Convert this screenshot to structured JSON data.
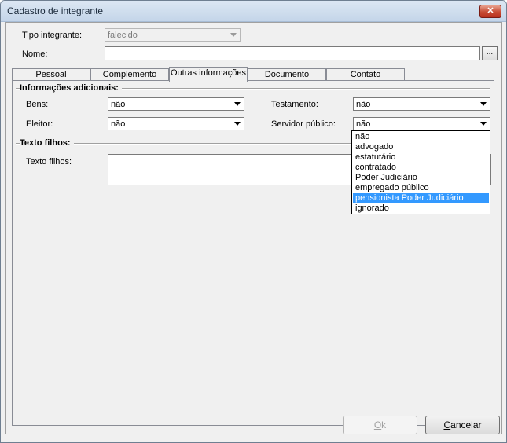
{
  "window": {
    "title": "Cadastro de integrante",
    "close_label": "✕"
  },
  "form": {
    "tipo_label": "Tipo integrante:",
    "tipo_value": "falecido",
    "nome_label": "Nome:",
    "nome_value": "",
    "ellipsis_label": "..."
  },
  "tabs": [
    {
      "label": "Pessoal"
    },
    {
      "label": "Complemento"
    },
    {
      "label": "Outras informações"
    },
    {
      "label": "Documento"
    },
    {
      "label": "Contato"
    }
  ],
  "group_adicionais": {
    "title": "Informações adicionais:",
    "bens_label": "Bens:",
    "bens_value": "não",
    "eleitor_label": "Eleitor:",
    "eleitor_value": "não",
    "testamento_label": "Testamento:",
    "testamento_value": "não",
    "servidor_label": "Servidor público:",
    "servidor_value": "não"
  },
  "group_filhos": {
    "title": "Texto filhos:",
    "field_label": "Texto filhos:"
  },
  "servidor_dropdown": {
    "items": [
      "não",
      "advogado",
      "estatutário",
      "contratado",
      "Poder Judiciário",
      "empregado público",
      "pensionista Poder Judiciário",
      "ignorado"
    ],
    "highlighted": "pensionista Poder Judiciário"
  },
  "buttons": {
    "ok_prefix": "",
    "ok_hot": "O",
    "ok_rest": "k",
    "cancel_hot": "C",
    "cancel_rest": "ancelar"
  }
}
